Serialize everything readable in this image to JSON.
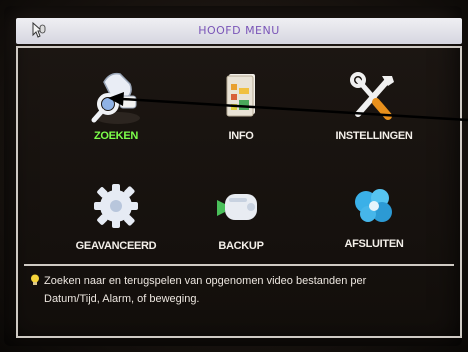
{
  "window": {
    "title": "HOOFD MENU"
  },
  "menu": {
    "items": [
      {
        "label": "ZOEKEN",
        "icon": "search-magnifier-icon",
        "active": true
      },
      {
        "label": "INFO",
        "icon": "info-document-icon",
        "active": false
      },
      {
        "label": "INSTELLINGEN",
        "icon": "tools-icon",
        "active": false
      },
      {
        "label": "GEAVANCEERD",
        "icon": "gear-icon",
        "active": false
      },
      {
        "label": "BACKUP",
        "icon": "backup-camera-icon",
        "active": false
      },
      {
        "label": "AFSLUITEN",
        "icon": "shutdown-icon",
        "active": false
      }
    ]
  },
  "status": {
    "hint_line1": "Zoeken naar en terugspelen van opgenomen video bestanden per",
    "hint_line2": "Datum/Tijd, Alarm, of beweging.",
    "icon": "lightbulb-icon"
  },
  "colors": {
    "active_label": "#7cff4a",
    "label": "#f3efe9",
    "title_text": "#7a55b8",
    "pointer_arrow": "#000000"
  }
}
